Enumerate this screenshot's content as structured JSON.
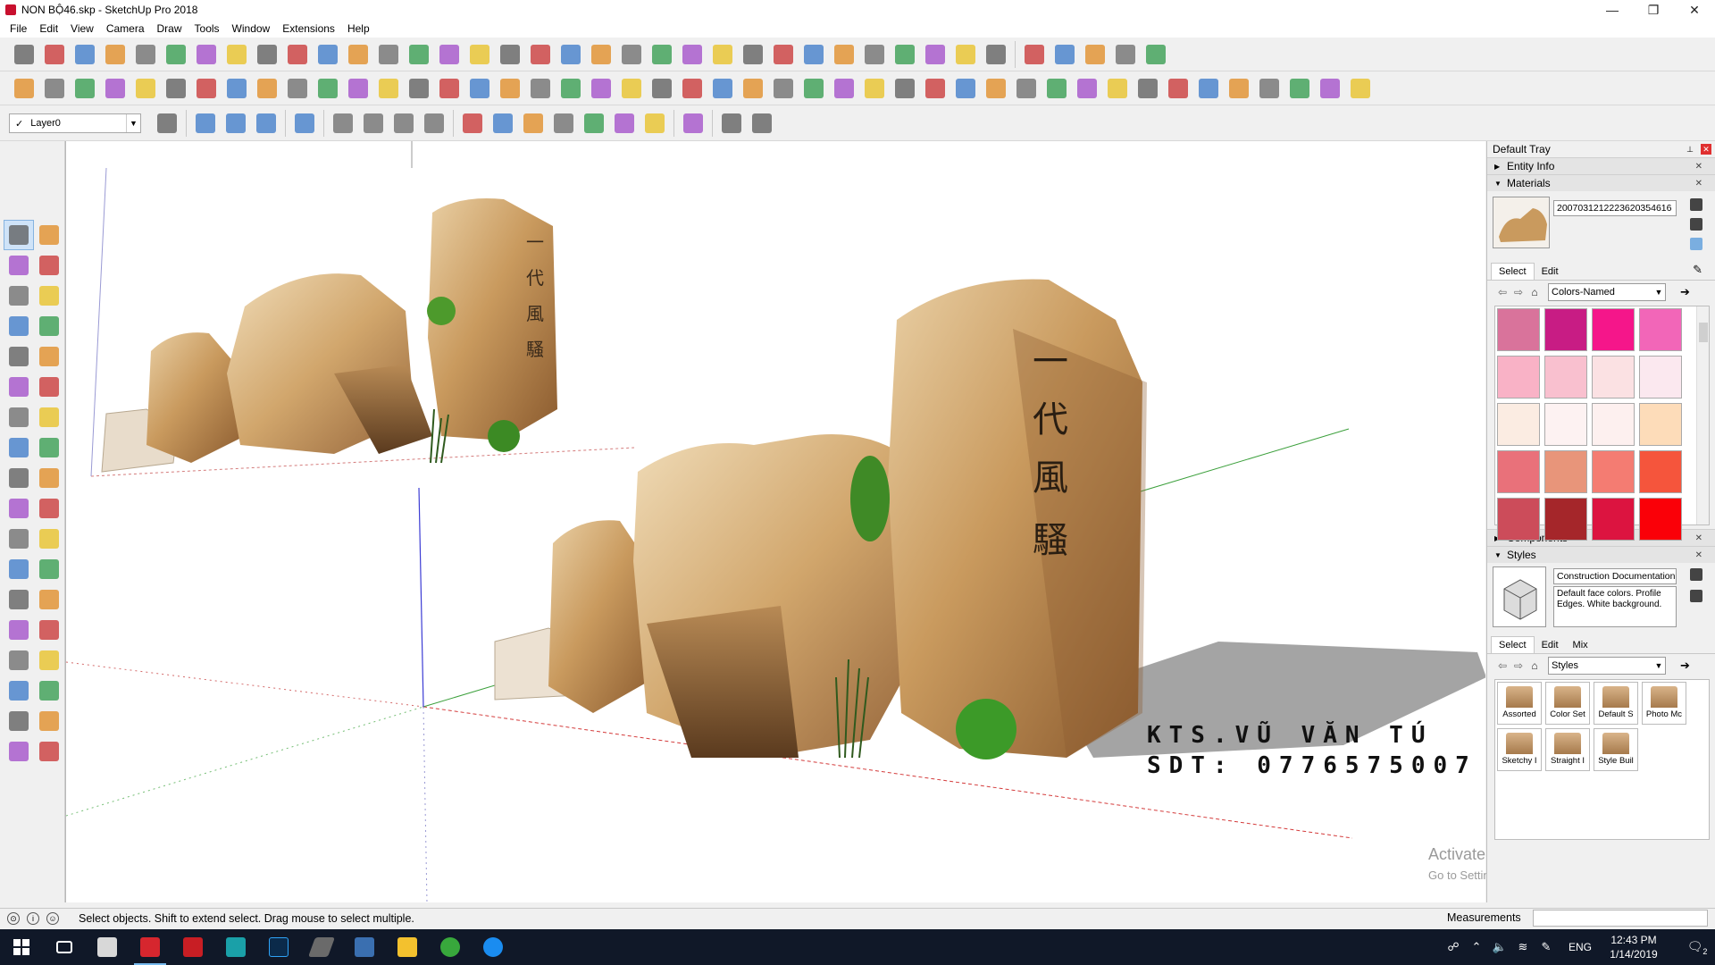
{
  "window": {
    "title": "NON BỘ46.skp - SketchUp Pro 2018",
    "controls": {
      "minimize": "—",
      "restore": "❐",
      "close": "✕"
    }
  },
  "menu": [
    "File",
    "Edit",
    "View",
    "Camera",
    "Draw",
    "Tools",
    "Window",
    "Extensions",
    "Help"
  ],
  "layer": {
    "check": "✓",
    "value": "Layer0"
  },
  "viewport": {
    "watermark_line1": "KTS.VŨ VĂN TÚ",
    "watermark_line2": "SDT: 0776575007"
  },
  "activate_windows": {
    "title": "Activate Windows",
    "subtitle": "Go to Settings to activate Windows."
  },
  "tray": {
    "title": "Default Tray",
    "panels": {
      "entity_info": "Entity Info",
      "materials": "Materials",
      "components": "Components",
      "styles": "Styles"
    },
    "materials": {
      "name": "2007031212223620354616",
      "tabs": [
        "Select",
        "Edit"
      ],
      "library": "Colors-Named",
      "swatches": [
        "#d9739b",
        "#c81c84",
        "#f5168a",
        "#f266b8",
        "#f9b2c6",
        "#f9c0cf",
        "#fbe1e3",
        "#fbe8ef",
        "#fbece2",
        "#fdf2f2",
        "#fdf0ef",
        "#fddcb9",
        "#e9717a",
        "#e8957a",
        "#f47c72",
        "#f5553c",
        "#cc4c5a",
        "#a5262a",
        "#dc1440",
        "#fa0008"
      ]
    },
    "styles": {
      "name": "Construction Documentation",
      "description": "Default face colors. Profile Edges. White background.",
      "tabs": [
        "Select",
        "Edit",
        "Mix"
      ],
      "library": "Styles",
      "items": [
        "Assorted",
        "Color Sets",
        "Default Styles",
        "Photo Modeling",
        "Sketchy Edges",
        "Straight Lines",
        "Style Builder"
      ],
      "items_display": [
        "Assorted",
        "Color Set",
        "Default S",
        "Photo Mc",
        "Sketchy I",
        "Straight I",
        "Style Buil"
      ]
    }
  },
  "status": {
    "text": "Select objects. Shift to extend select. Drag mouse to select multiple.",
    "measurements_label": "Measurements"
  },
  "taskbar": {
    "lang": "ENG",
    "time": "12:43 PM",
    "date": "1/14/2019",
    "notification_count": "2"
  },
  "colors": {
    "viewport_bg": "#ffffff",
    "taskbar_bg": "#101828",
    "axis_red": "#d43c3c",
    "axis_green": "#3ca03c",
    "axis_blue": "#3c3cd4"
  }
}
